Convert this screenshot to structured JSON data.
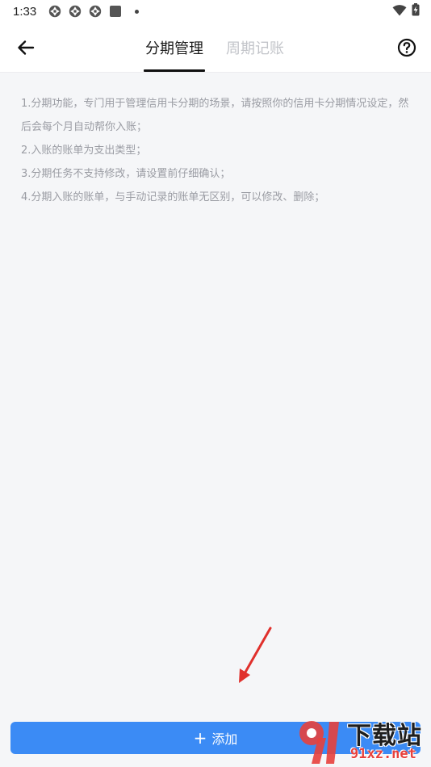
{
  "status_bar": {
    "time": "1:33",
    "icons": [
      "aperture-icon",
      "aperture-icon",
      "aperture-icon",
      "square-icon",
      "dot-icon"
    ],
    "right_icons": [
      "wifi-icon",
      "battery-charging-icon"
    ]
  },
  "header": {
    "back_icon": "arrow-left-icon",
    "help_icon": "question-circle-icon",
    "tabs": [
      {
        "label": "分期管理",
        "active": true
      },
      {
        "label": "周期记账",
        "active": false
      }
    ]
  },
  "notes": [
    "1.分期功能，专门用于管理信用卡分期的场景，请按照你的信用卡分期情况设定，然后会每个月自动帮你入账；",
    "2.入账的账单为支出类型；",
    "3.分期任务不支持修改，请设置前仔细确认；",
    "4.分期入账的账单，与手动记录的账单无区别，可以修改、删除；"
  ],
  "add_button": {
    "icon": "plus-icon",
    "label": "添加"
  },
  "watermark": {
    "title": "下载站",
    "url": "91xz.net"
  },
  "colors": {
    "accent": "#3b8bf5",
    "background": "#f5f6f8",
    "muted_text": "#9a9ca3",
    "inactive_tab": "#c2c4c9",
    "annotation_arrow": "#e0302c"
  }
}
